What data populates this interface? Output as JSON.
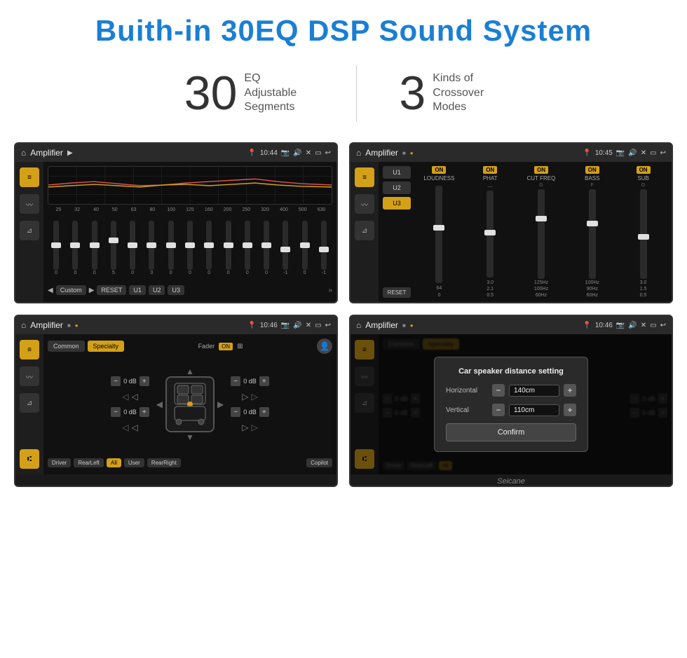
{
  "page": {
    "title": "Buith-in 30EQ DSP Sound System",
    "stats": [
      {
        "number": "30",
        "label": "EQ Adjustable\nSegments"
      },
      {
        "number": "3",
        "label": "Kinds of\nCrossover Modes"
      }
    ]
  },
  "screens": {
    "eq_screen": {
      "status": {
        "title": "Amplifier",
        "time": "10:44"
      },
      "freq_labels": [
        "25",
        "32",
        "40",
        "50",
        "63",
        "80",
        "100",
        "125",
        "160",
        "200",
        "250",
        "320",
        "400",
        "500",
        "630"
      ],
      "slider_values": [
        "0",
        "0",
        "0",
        "5",
        "0",
        "0",
        "0",
        "0",
        "0",
        "0",
        "0",
        "0",
        "-1",
        "0",
        "-1"
      ],
      "buttons": [
        "Custom",
        "RESET",
        "U1",
        "U2",
        "U3"
      ]
    },
    "crossover_screen": {
      "status": {
        "title": "Amplifier",
        "time": "10:45"
      },
      "presets": [
        "U1",
        "U2",
        "U3"
      ],
      "active_preset": "U3",
      "channels": [
        {
          "name": "LOUDNESS",
          "on": true
        },
        {
          "name": "PHAT",
          "on": true
        },
        {
          "name": "CUT FREQ",
          "on": true
        },
        {
          "name": "BASS",
          "on": true
        },
        {
          "name": "SUB",
          "on": true
        }
      ]
    },
    "specialty_screen": {
      "status": {
        "title": "Amplifier",
        "time": "10:46"
      },
      "tabs": [
        "Common",
        "Specialty"
      ],
      "active_tab": "Specialty",
      "fader_label": "Fader",
      "fader_on": "ON",
      "speaker_values": {
        "fl": "0 dB",
        "fr": "0 dB",
        "rl": "0 dB",
        "rr": "0 dB"
      },
      "footer_buttons": [
        "Driver",
        "RearLeft",
        "All",
        "User",
        "RearRight",
        "Copilot"
      ]
    },
    "dialog_screen": {
      "status": {
        "title": "Amplifier",
        "time": "10:46"
      },
      "dialog": {
        "title": "Car speaker distance setting",
        "horizontal_label": "Horizontal",
        "horizontal_value": "140cm",
        "vertical_label": "Vertical",
        "vertical_value": "110cm",
        "confirm_label": "Confirm"
      }
    }
  },
  "watermark": "Seicane"
}
